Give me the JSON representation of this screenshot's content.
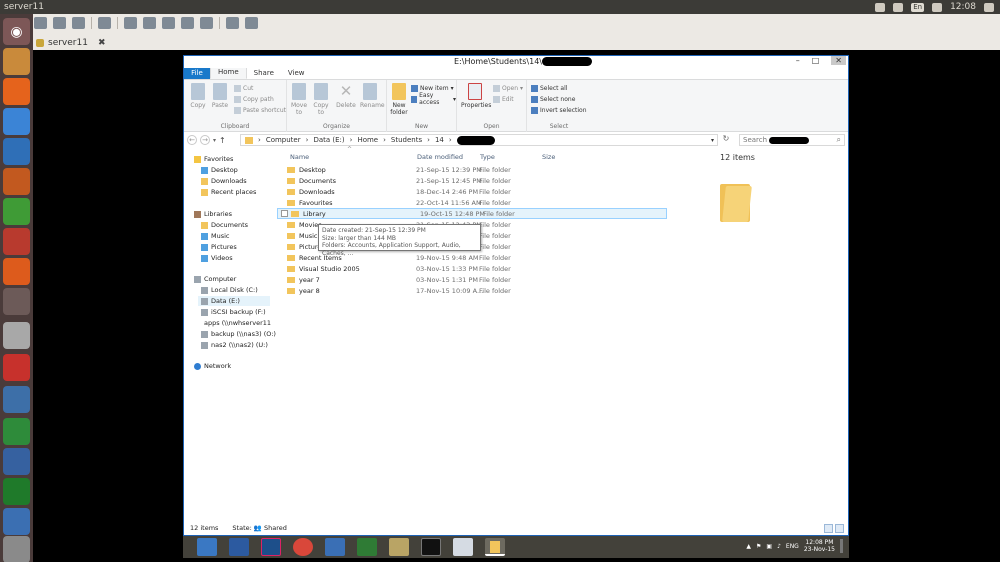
{
  "host": {
    "title": "server11",
    "clock": "12:08",
    "keyboard": "En"
  },
  "client": {
    "tab_label": "server11"
  },
  "window": {
    "path": "E:\\Home\\Students\\14\\",
    "controls": [
      "–",
      "□",
      "✕"
    ]
  },
  "ribbon": {
    "tabs": [
      "File",
      "Home",
      "Share",
      "View"
    ],
    "clipboard": {
      "copy": "Copy",
      "paste": "Paste",
      "cut": "Cut",
      "copy_path": "Copy path",
      "paste_shortcut": "Paste shortcut",
      "label": "Clipboard"
    },
    "organize": {
      "move_to": "Move to",
      "copy_to": "Copy to",
      "delete": "Delete",
      "rename": "Rename",
      "label": "Organize"
    },
    "new": {
      "new_folder": "New folder",
      "new_item": "New item",
      "easy_access": "Easy access",
      "label": "New"
    },
    "open": {
      "properties": "Properties",
      "open": "Open",
      "edit": "Edit",
      "label": "Open"
    },
    "select": {
      "select_all": "Select all",
      "select_none": "Select none",
      "invert": "Invert selection",
      "label": "Select"
    }
  },
  "address": {
    "crumbs": [
      "Computer",
      "Data (E:)",
      "Home",
      "Students",
      "14"
    ],
    "search_placeholder": "Search"
  },
  "nav": {
    "favorites": "Favorites",
    "desktop": "Desktop",
    "downloads": "Downloads",
    "recent": "Recent places",
    "libraries": "Libraries",
    "documents": "Documents",
    "music": "Music",
    "pictures": "Pictures",
    "videos": "Videos",
    "computer": "Computer",
    "local_disk": "Local Disk (C:)",
    "data": "Data (E:)",
    "iscsi": "iSCSI backup (F:)",
    "apps": "apps (\\\\nwhserver11) (",
    "backup": "backup (\\\\nas3) (O:)",
    "nas2": "nas2 (\\\\nas2) (U:)",
    "network": "Network"
  },
  "columns": {
    "name": "Name",
    "date": "Date modified",
    "type": "Type",
    "size": "Size"
  },
  "files": [
    {
      "name": "Desktop",
      "date": "21-Sep-15 12:39 PM",
      "type": "File folder"
    },
    {
      "name": "Documents",
      "date": "21-Sep-15 12:45 PM",
      "type": "File folder"
    },
    {
      "name": "Downloads",
      "date": "18-Dec-14 2:46 PM",
      "type": "File folder"
    },
    {
      "name": "Favourites",
      "date": "22-Oct-14 11:56 AM",
      "type": "File folder"
    },
    {
      "name": "Library",
      "date": "19-Oct-15 12:48 PM",
      "type": "File folder"
    },
    {
      "name": "Movies",
      "date": "21-Sep-15 12:43 PM",
      "type": "File folder"
    },
    {
      "name": "Music",
      "date": "",
      "type": "File folder"
    },
    {
      "name": "Pictures",
      "date": "",
      "type": "File folder"
    },
    {
      "name": "Recent Items",
      "date": "19-Nov-15 9:48 AM",
      "type": "File folder"
    },
    {
      "name": "Visual Studio 2005",
      "date": "03-Nov-15 1:33 PM",
      "type": "File folder"
    },
    {
      "name": "year 7",
      "date": "03-Nov-15 1:31 PM",
      "type": "File folder"
    },
    {
      "name": "year 8",
      "date": "17-Nov-15 10:09 A...",
      "type": "File folder"
    }
  ],
  "tooltip": {
    "line1": "Date created: 21-Sep-15 12:39 PM",
    "line2": "Size: larger than 144 MB",
    "line3": "Folders: Accounts, Application Support, Audio, Caches, ..."
  },
  "preview": {
    "count": "12 items"
  },
  "status": {
    "count": "12 items",
    "state": "State: 👥 Shared"
  },
  "taskbar": {
    "lang": "ENG",
    "time": "12:08 PM",
    "date": "23-Nov-15"
  }
}
